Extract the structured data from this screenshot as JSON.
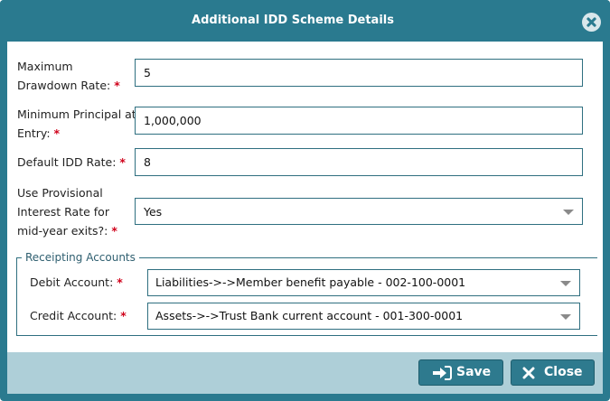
{
  "dialog": {
    "title": "Additional IDD Scheme Details",
    "close_icon": "close-circle-icon"
  },
  "form": {
    "max_drawdown": {
      "label": "Maximum Drawdown Rate:",
      "required": "*",
      "value": "5"
    },
    "min_principal": {
      "label": "Minimum Principal at Entry:",
      "required": "*",
      "value": "1,000,000"
    },
    "default_idd": {
      "label": "Default IDD Rate:",
      "required": "*",
      "value": "8"
    },
    "provisional": {
      "label": "Use Provisional Interest Rate for mid-year exits?:",
      "required": "*",
      "value": "Yes"
    }
  },
  "receipting": {
    "legend": "Receipting Accounts",
    "debit": {
      "label": "Debit Account:",
      "required": "*",
      "value": "Liabilities->->Member benefit payable - 002-100-0001"
    },
    "credit": {
      "label": "Credit Account:",
      "required": "*",
      "value": "Assets->->Trust Bank current account - 001-300-0001"
    }
  },
  "footer": {
    "save_label": "Save",
    "save_icon": "sign-in-icon",
    "close_label": "Close",
    "close_icon": "x-icon"
  },
  "colors": {
    "header": "#2a7a8f",
    "footer": "#aecfd8",
    "button": "#2e7a8e",
    "required": "#d0021b"
  }
}
